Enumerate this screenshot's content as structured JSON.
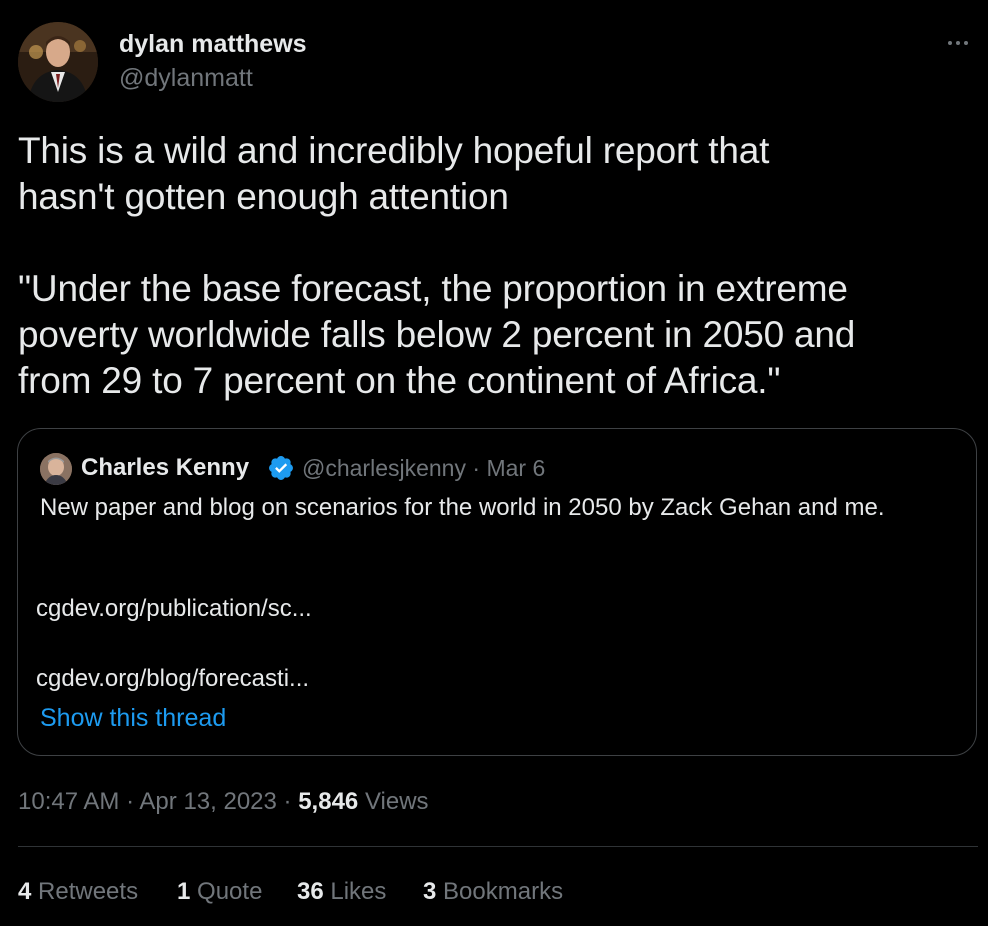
{
  "author": {
    "name": "dylan matthews",
    "handle": "@dylanmatt"
  },
  "tweet": {
    "text": "This is a wild and incredibly hopeful report that\nhasn't gotten enough attention\n\n\"Under the base forecast, the proportion in extreme\npoverty worldwide falls below 2 percent in 2050 and\nfrom 29 to 7 percent on the continent of Africa.\""
  },
  "quote": {
    "author_name": "Charles Kenny",
    "handle": "@charlesjkenny",
    "separator": "·",
    "date": "Mar 6",
    "text": "New paper and blog on scenarios for the world in 2050 by Zack Gehan and me.",
    "link1": "cgdev.org/publication/sc...",
    "link2": "cgdev.org/blog/forecasti...",
    "show_thread": "Show this thread"
  },
  "meta": {
    "time": "10:47 AM",
    "separator": "·",
    "date": "Apr 13, 2023",
    "views_count": "5,846",
    "views_label": "Views"
  },
  "stats": {
    "retweets_count": "4",
    "retweets_label": "Retweets",
    "quotes_count": "1",
    "quotes_label": "Quote",
    "likes_count": "36",
    "likes_label": "Likes",
    "bookmarks_count": "3",
    "bookmarks_label": "Bookmarks"
  },
  "colors": {
    "background": "#000000",
    "text_primary": "#e7e9ea",
    "text_secondary": "#71767b",
    "link": "#1d9bf0",
    "verified": "#1d9bf0",
    "border": "#2f3336"
  },
  "icons": {
    "more": "more-horizontal-icon",
    "verified": "verified-badge-icon"
  }
}
